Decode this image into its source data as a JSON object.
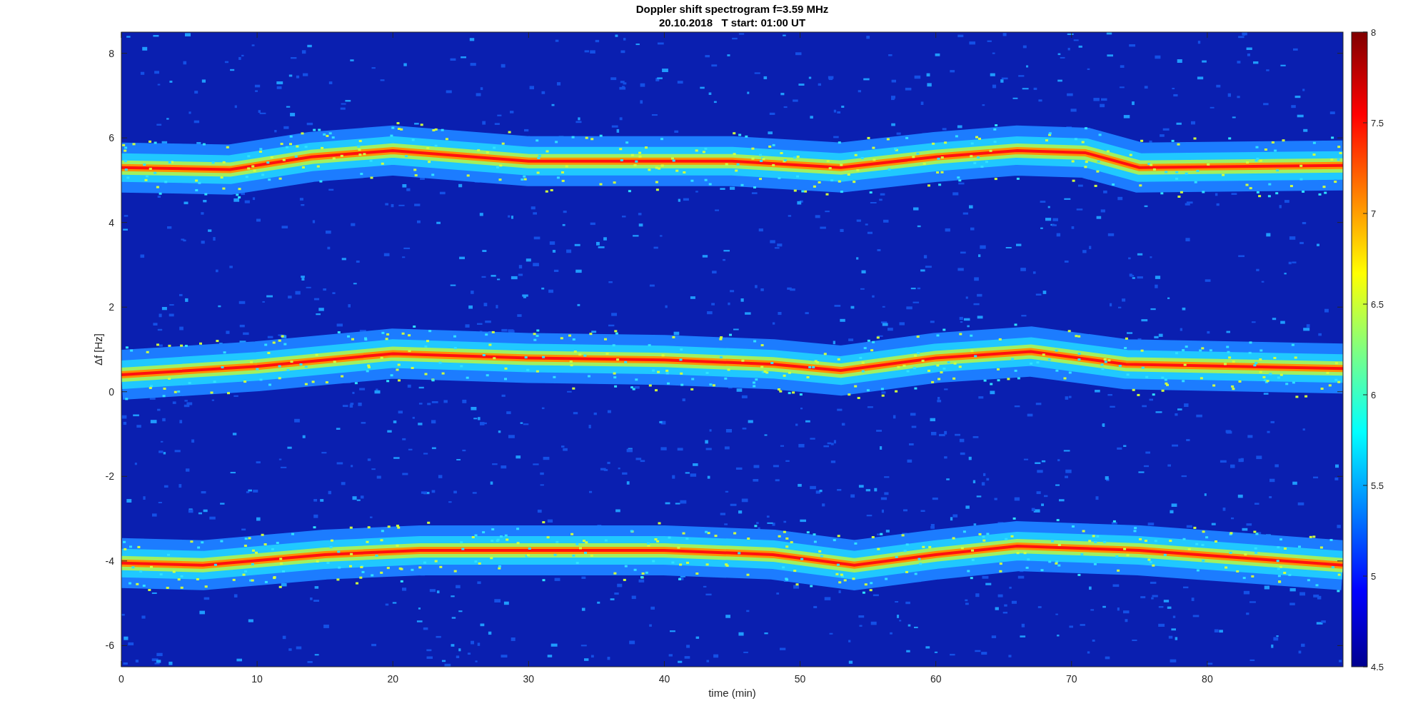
{
  "figure": {
    "title": "Doppler shift spectrogram f=3.59 MHz",
    "subtitle": "20.10.2018   T start: 01:00 UT"
  },
  "axes": {
    "xlabel": "time (min)",
    "ylabel": "Δf [Hz]",
    "xticks": [
      "0",
      "10",
      "20",
      "30",
      "40",
      "50",
      "60",
      "70",
      "80"
    ],
    "yticks": [
      "8",
      "6",
      "4",
      "2",
      "0",
      "-2",
      "-4",
      "-6"
    ]
  },
  "colorbar": {
    "ticks": [
      "8",
      "7.5",
      "7",
      "6.5",
      "6",
      "5.5",
      "5",
      "4.5"
    ]
  }
}
